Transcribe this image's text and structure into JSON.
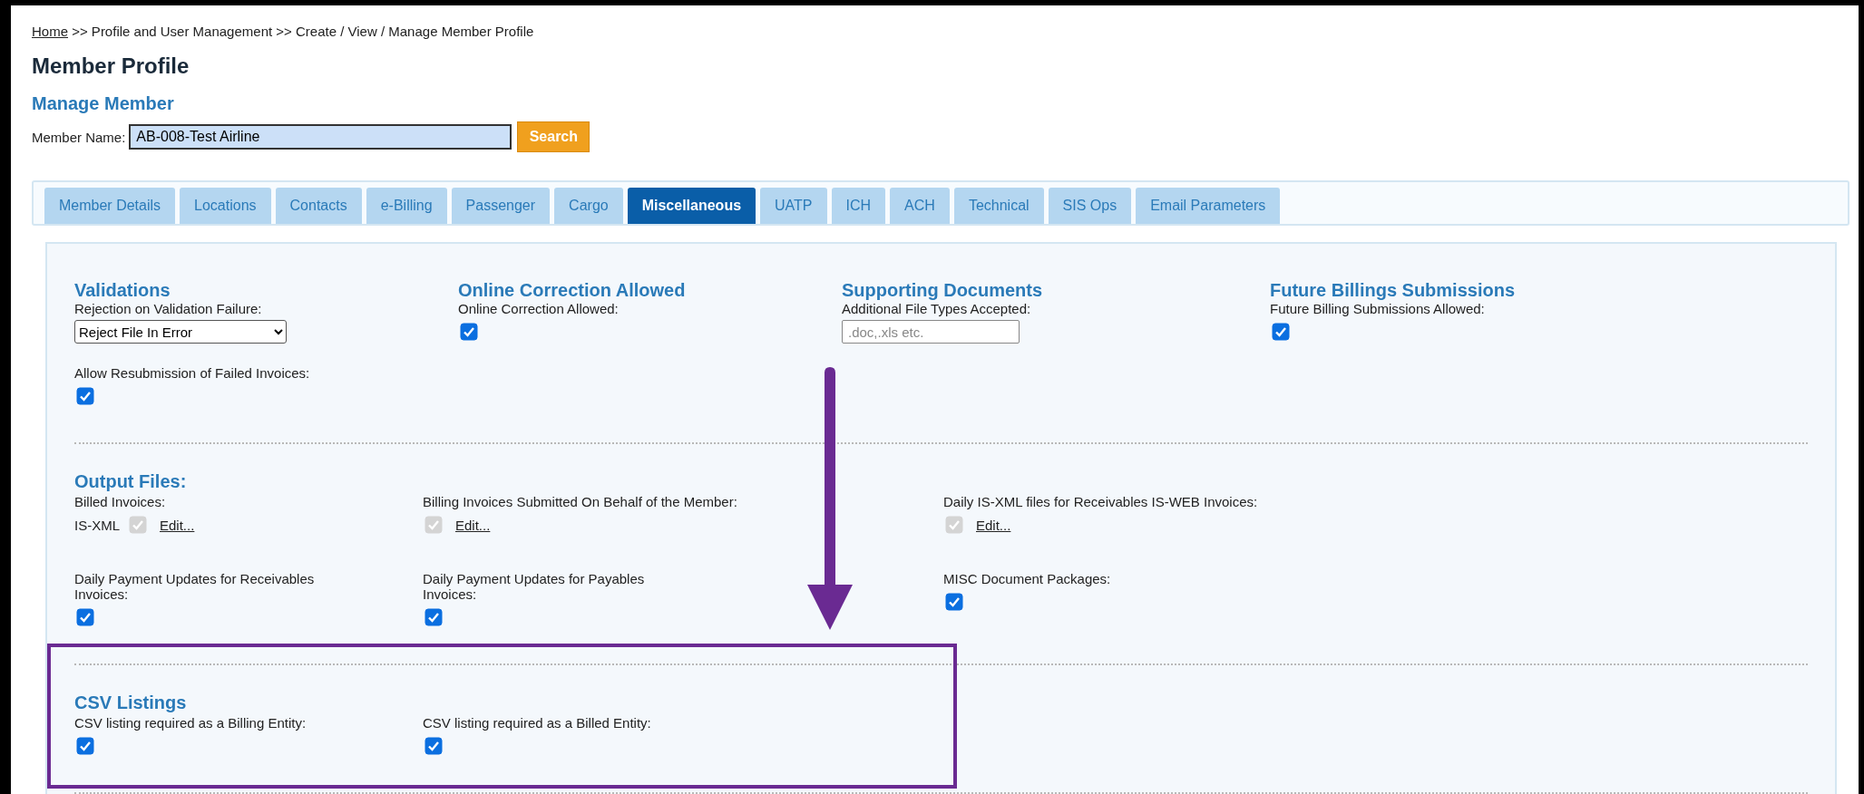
{
  "breadcrumb": {
    "link": "Home",
    "trail": " >> Profile and User Management >> Create / View / Manage Member Profile"
  },
  "page_title": "Member Profile",
  "subtitle": "Manage Member",
  "member_search": {
    "label": "Member Name:",
    "value": "AB-008-Test Airline",
    "button": "Search"
  },
  "tabs": [
    {
      "label": "Member Details",
      "selected": false
    },
    {
      "label": "Locations",
      "selected": false
    },
    {
      "label": "Contacts",
      "selected": false
    },
    {
      "label": "e-Billing",
      "selected": false
    },
    {
      "label": "Passenger",
      "selected": false
    },
    {
      "label": "Cargo",
      "selected": false
    },
    {
      "label": "Miscellaneous",
      "selected": true
    },
    {
      "label": "UATP",
      "selected": false
    },
    {
      "label": "ICH",
      "selected": false
    },
    {
      "label": "ACH",
      "selected": false
    },
    {
      "label": "Technical",
      "selected": false
    },
    {
      "label": "SIS Ops",
      "selected": false
    },
    {
      "label": "Email Parameters",
      "selected": false
    }
  ],
  "sections": [
    {
      "rows": [
        [
          {
            "heading": "Validations",
            "fields": [
              {
                "kind": "select",
                "label": "Rejection on Validation Failure:",
                "value": "Reject File In Error"
              },
              {
                "kind": "checkbox",
                "label": "Allow Resubmission of Failed Invoices:",
                "checked": true
              }
            ]
          },
          {
            "heading": "Online Correction Allowed",
            "fields": [
              {
                "kind": "checkbox",
                "label": "Online Correction Allowed:",
                "checked": true
              }
            ]
          },
          {
            "heading": "Supporting Documents",
            "fields": [
              {
                "kind": "text",
                "label": "Additional File Types Accepted:",
                "placeholder": ".doc,.xls etc."
              }
            ]
          },
          {
            "heading": "Future Billings Submissions",
            "fields": [
              {
                "kind": "checkbox",
                "label": "Future Billing Submissions Allowed:",
                "checked": true
              }
            ]
          }
        ]
      ]
    },
    {
      "title": "Output Files:",
      "rows": [
        [
          {
            "fields": [
              {
                "kind": "output",
                "label": "Billed Invoices:",
                "prefix": "IS-XML",
                "checked": true,
                "disabled": true,
                "link": "Edit..."
              }
            ]
          },
          {
            "fields": [
              {
                "kind": "output",
                "label": "Billing Invoices Submitted On Behalf of the Member:",
                "checked": true,
                "disabled": true,
                "link": "Edit..."
              }
            ]
          },
          {
            "fields": [
              {
                "kind": "output",
                "label": "Daily IS-XML files for Receivables IS-WEB Invoices:",
                "checked": true,
                "disabled": true,
                "link": "Edit..."
              }
            ]
          }
        ],
        [
          {
            "fields": [
              {
                "kind": "checkbox",
                "label": "Daily Payment Updates for Receivables Invoices:",
                "checked": true
              }
            ]
          },
          {
            "fields": [
              {
                "kind": "checkbox",
                "label": "Daily Payment Updates for Payables Invoices:",
                "checked": true
              }
            ]
          },
          {
            "fields": [
              {
                "kind": "checkbox",
                "label": "MISC Document Packages:",
                "checked": true
              }
            ]
          }
        ]
      ]
    },
    {
      "title": "CSV Listings",
      "rows": [
        [
          {
            "fields": [
              {
                "kind": "checkbox",
                "label": "CSV listing required as a Billing Entity:",
                "checked": true
              }
            ]
          },
          {
            "fields": [
              {
                "kind": "checkbox",
                "label": "CSV listing required as a Billed Entity:",
                "checked": true
              }
            ]
          }
        ]
      ]
    }
  ],
  "annotations": [
    {
      "kind": "arrow"
    },
    {
      "kind": "frame"
    }
  ]
}
